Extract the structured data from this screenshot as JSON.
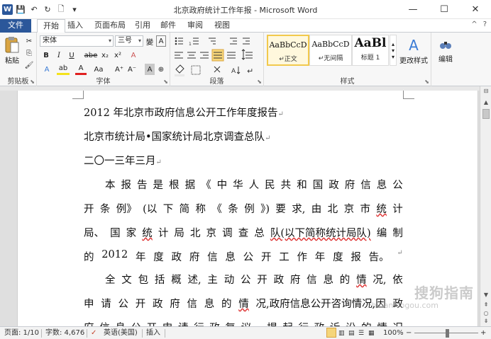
{
  "window": {
    "title": "北京政府统计工作年报 - Microsoft Word",
    "app_icon": "W",
    "controls": {
      "minimize": "—",
      "maximize": "☐",
      "close": "✕"
    }
  },
  "quick_access": {
    "save": "💾",
    "undo": "↶",
    "redo": "↻",
    "new": "🗋",
    "customize": "▾"
  },
  "tabs": {
    "file": "文件",
    "items": [
      "开始",
      "插入",
      "页面布局",
      "引用",
      "邮件",
      "审阅",
      "视图"
    ],
    "active": "开始",
    "help": "?",
    "collapse": "^"
  },
  "ribbon": {
    "clipboard": {
      "label": "剪贴板",
      "paste": "粘贴",
      "cut": "✂",
      "copy": "⎘",
      "format_painter": "🖌"
    },
    "font": {
      "label": "字体",
      "font_name": "宋体",
      "font_size": "三号",
      "wen": "變",
      "char_border": "A",
      "bold": "B",
      "italic": "I",
      "underline": "U",
      "strike": "abe",
      "subscript": "x₂",
      "superscript": "x²",
      "clear": "A",
      "effects": "A",
      "highlight": "ab",
      "font_color": "A",
      "case": "Aa",
      "grow": "A⁺",
      "shrink": "A⁻",
      "char_shading": "A",
      "enclose": "⊕"
    },
    "paragraph": {
      "label": "段落"
    },
    "styles": {
      "label": "样式",
      "items": [
        {
          "sample": "AaBbCcD",
          "name": "↵正文"
        },
        {
          "sample": "AaBbCcD",
          "name": "↵无间隔"
        },
        {
          "sample": "AaBl",
          "name": "标题 1"
        }
      ],
      "change_styles": "更改样式"
    },
    "editing": {
      "label": "编辑",
      "name": "编辑"
    }
  },
  "document": {
    "lines": [
      "2012 年北京市政府信息公开工作年度报告",
      "北京市统计局•国家统计局北京调查总队",
      "二〇一三年三月"
    ],
    "para1": [
      [
        "本",
        "报",
        "告",
        "是",
        "根",
        "据",
        "《",
        "中",
        "华",
        "人",
        "民",
        "共",
        "和",
        "国",
        "政",
        "府",
        "信",
        "息",
        "公"
      ],
      [
        "开",
        "条",
        "例》",
        "(以",
        "下",
        "简",
        "称",
        "《",
        "条",
        "例",
        "》)",
        "要",
        "求,",
        "由",
        "北",
        "京",
        "市",
        "统",
        "计"
      ],
      [
        "局、",
        "国",
        "家",
        "统",
        "计",
        "局",
        "北",
        "京",
        "调",
        "查",
        "总",
        "队(以下简称统计局队)",
        "编",
        "制"
      ],
      [
        "的",
        "2012",
        "年",
        "度",
        "政",
        "府",
        "信",
        "息",
        "公",
        "开",
        "工",
        "作",
        "年",
        "度",
        "报",
        "告。"
      ]
    ],
    "para2": [
      [
        "全",
        "文",
        "包",
        "括",
        "概",
        "述,",
        "主",
        "动",
        "公",
        "开",
        "政",
        "府",
        "信",
        "息",
        "的",
        "情",
        "况,",
        "依"
      ],
      [
        "申",
        "请",
        "公",
        "开",
        "政",
        "府",
        "信",
        "息",
        "的",
        "情",
        "况,政府信息公开咨询情况,因",
        "政"
      ],
      [
        "府",
        "信",
        "息",
        "公",
        "开",
        "申",
        "请",
        "行",
        "政",
        "复",
        "议、",
        "提",
        "起",
        "行",
        "政",
        "诉",
        "讼",
        "的",
        "情",
        "况"
      ]
    ]
  },
  "watermark": {
    "text": "搜狗指南",
    "url": "zhinan.sogou.com"
  },
  "status": {
    "page": "页面: 1/10",
    "words": "字数: 4,676",
    "language": "英语(美国)",
    "mode": "插入",
    "zoom": "100%",
    "zoom_minus": "−",
    "zoom_plus": "+",
    "zoom_level": 0.5
  }
}
